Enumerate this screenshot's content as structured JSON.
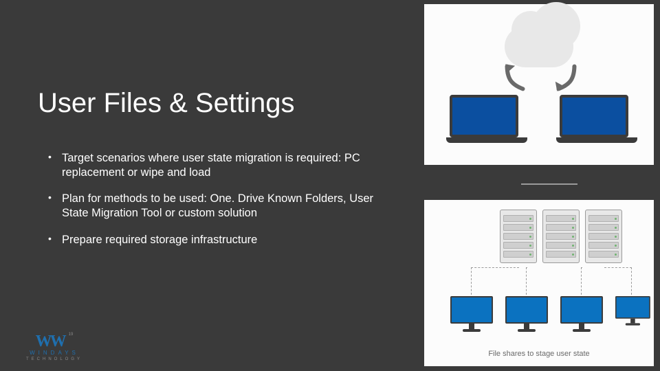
{
  "title": "User Files & Settings",
  "bullets": [
    "Target scenarios where user state migration is required: PC replacement or wipe and load",
    "Plan for methods to be used: One. Drive Known Folders, User State Migration Tool or custom solution",
    "Prepare required storage infrastructure"
  ],
  "images": {
    "top_alt": "Two laptops syncing data through a cloud",
    "bottom_alt": "Server racks connected to client monitors",
    "bottom_caption": "File shares to stage user state"
  },
  "logo": {
    "brand": "WINDAYS",
    "sub": "TECHNOLOGY",
    "tm": "19"
  },
  "colors": {
    "background": "#3a3a3a",
    "panel": "#fcfcfc",
    "accent_blue": "#0b72c0",
    "logo_blue": "#1f6fae"
  }
}
